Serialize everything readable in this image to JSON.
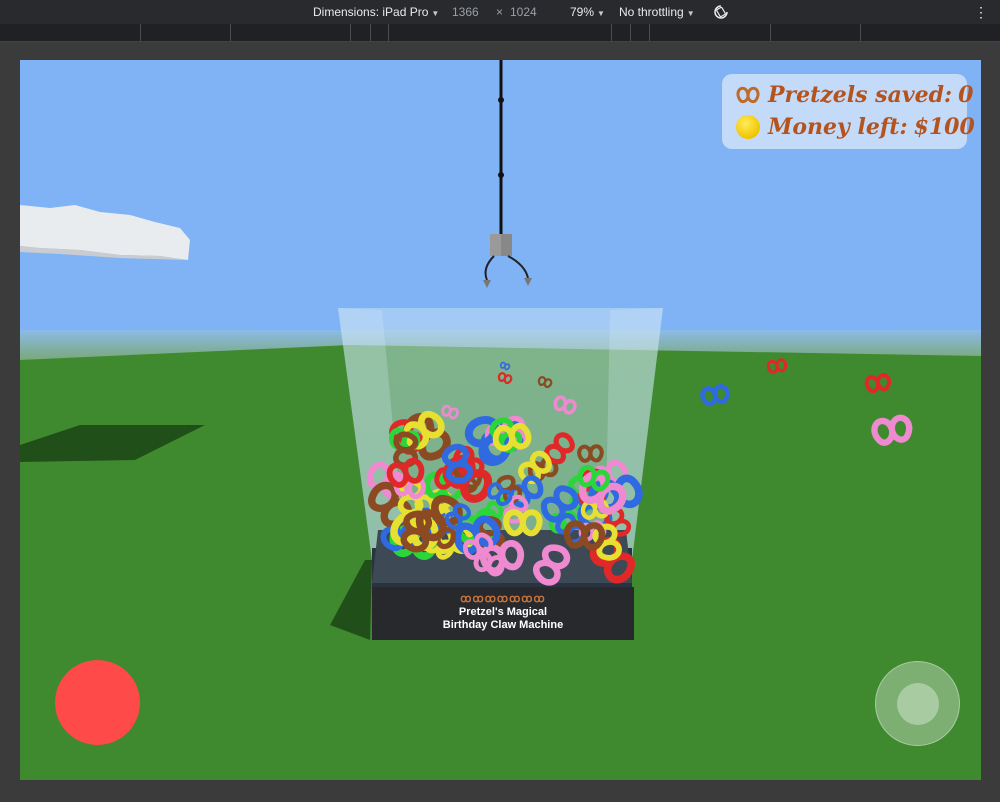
{
  "devtools": {
    "dimensions_label": "Dimensions: iPad Pro",
    "width": "1366",
    "times": "×",
    "height": "1024",
    "zoom": "79%",
    "throttling": "No throttling",
    "rotate_icon": "rotate-icon",
    "more_icon": "more-vertical-icon"
  },
  "hud": {
    "pretzels_label": "Pretzels saved:",
    "pretzels_value": "0",
    "money_label": "Money left:",
    "money_value": "$100",
    "pretzel_icon": "pretzel-icon",
    "coin_icon": "coin-icon"
  },
  "machine": {
    "decoration": "ꝏꝏꝏꝏꝏꝏꝏ",
    "line1": "Pretzel's Magical",
    "line2": "Birthday Claw Machine"
  },
  "colors": {
    "sky": "#7fb3f5",
    "grass": "#3f8a2f",
    "grab_button": "#ff4a4a",
    "hud_text": "#b5531f",
    "pretzel_colors": [
      "#e8e030",
      "#2bd63a",
      "#f08ad0",
      "#2f6ae0",
      "#e02828",
      "#8b4a22"
    ]
  },
  "controls": {
    "grab_button": "grab-button",
    "joystick": "joystick"
  }
}
